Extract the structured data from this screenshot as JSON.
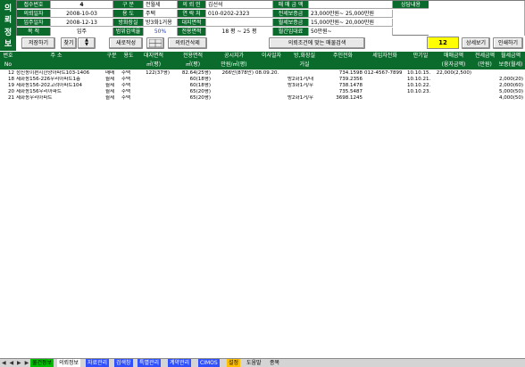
{
  "badge": [
    "의",
    "뢰",
    "정",
    "보"
  ],
  "form": {
    "row1": {
      "lbl_no": "접수번호",
      "val_no": "4",
      "lbl_type": "구    분",
      "val_type": "전월세",
      "lbl_client": "의 뢰 인",
      "val_client": "김선석",
      "lbl_sale": "매 매 금 액",
      "val_sale": "",
      "lbl_note": "상담내용"
    },
    "row2": {
      "lbl_date": "의뢰일자",
      "val_date": "2008-10-03",
      "lbl_use": "용    도",
      "val_use": "주택",
      "lbl_phone": "연 락 처",
      "val_phone": "010-0202-2323",
      "lbl_jeonse": "전세보증금",
      "val_jeonse": "23,000만원~ 25,000만원"
    },
    "row3": {
      "lbl_move": "입주일자",
      "val_move": "2008-12-13",
      "lbl_room": "방화장실",
      "val_room": "방3화1거용",
      "lbl_land": "대지면적",
      "val_land": "",
      "lbl_wdep": "월세보증금",
      "val_wdep": "15,000만원~ 20,000만원"
    },
    "row4": {
      "lbl_purpose": "목    적",
      "val_purpose": "입주",
      "lbl_ratio": "범위검색율",
      "val_ratio": "50%",
      "lbl_excl": "전용면적",
      "val_excl": "18 평 ~ 25 평",
      "lbl_rent": "월간임대료",
      "val_rent": "50만원~"
    }
  },
  "toolbar": {
    "save": "저장하기",
    "find_label": "찾기",
    "new": "새로작성",
    "client_search": "의뢰건삭제",
    "match": "의뢰조건에 맞는 매물검색",
    "count": "12",
    "detail": "상세보기",
    "print": "인쇄하기"
  },
  "table": {
    "headers": [
      "번호",
      "주    소",
      "구분",
      "용도",
      "대지면적",
      "전용면적",
      "공시지가",
      "이사일자",
      "방,화장실",
      "주인전화",
      "세입자전화",
      "만기일",
      "매매금액",
      "전세금액",
      "월세금액"
    ],
    "subheaders": [
      "No",
      "",
      "",
      "",
      "㎡(평)",
      "㎡(평)",
      "만원/㎡(평)",
      "",
      "거실",
      "",
      "",
      "",
      "(융자금액)",
      "(만원)",
      "보증(월세)"
    ],
    "rows": [
      [
        "12",
        "청진동이편지한양아파트103-1406",
        "매매",
        "주택",
        "122(37평)",
        "82.64(25평)",
        "266만(878만)",
        "08.09.20.",
        "",
        "734.1598",
        "012-4567-7899",
        "10.10.15.",
        "22,000(2,500)",
        "",
        ""
      ],
      [
        "18",
        "세화동156-226우리아파트1층",
        "월세",
        "주택",
        "",
        "60(18평)",
        "",
        "",
        "방2화1거/대",
        "739.2356",
        "",
        "10.10.21.",
        "",
        "",
        "2,000(20)"
      ],
      [
        "19",
        "세화동156-202고려아파트104",
        "월세",
        "주택",
        "",
        "60(18평)",
        "",
        "",
        "방3화1거/우",
        "738.1478",
        "",
        "10.10.22.",
        "",
        "",
        "2,000(60)"
      ],
      [
        "20",
        "세화동156우리아파트",
        "월세",
        "주택",
        "",
        "65(20평)",
        "",
        "",
        "",
        "735.5487",
        "",
        "10.10.23.",
        "",
        "",
        "5,000(50)"
      ],
      [
        "21",
        "세화동우리아파트",
        "월세",
        "주택",
        "",
        "65(20평)",
        "",
        "",
        "방2화1거/우",
        "3698.1245",
        "",
        "",
        "",
        "",
        "4,000(50)"
      ]
    ]
  },
  "tabs": {
    "nav": "◀ ◀ ▶ ▶",
    "items": [
      "물건정보",
      "의뢰정보",
      "자료관리",
      "검색창",
      "특별관리",
      "계약관리",
      "CIMOS",
      "설정",
      "도움말",
      "종목"
    ],
    "colors": {
      "active": "#00c000",
      "blue": "#3050ff",
      "yellow": "#ffff00",
      "orange": "#ffc000"
    }
  }
}
